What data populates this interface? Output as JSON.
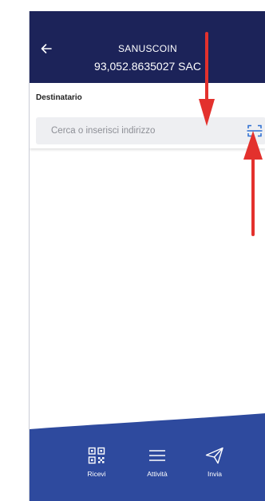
{
  "header": {
    "title": "SANUSCOIN",
    "balance": "93,052.8635027 SAC"
  },
  "recipient": {
    "label": "Destinatario",
    "placeholder": "Cerca o inserisci indirizzo",
    "value": ""
  },
  "nav": {
    "items": [
      {
        "label": "Ricevi",
        "icon": "qr-code-icon"
      },
      {
        "label": "Attività",
        "icon": "list-lines-icon"
      },
      {
        "label": "Invia",
        "icon": "paper-plane-icon"
      }
    ]
  },
  "colors": {
    "header_bg": "#1c2359",
    "nav_bg": "#2e4a9e",
    "field_bg": "#eeeff2",
    "scan_icon": "#2c6fd1",
    "annotation_arrow": "#e3312d"
  }
}
